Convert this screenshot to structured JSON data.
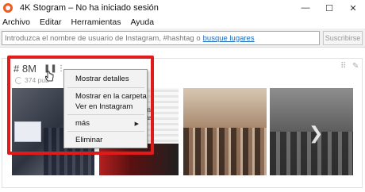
{
  "window": {
    "title": "4K Stogram – No ha iniciado sesión",
    "minimize": "—",
    "maximize": "☐",
    "close": "✕"
  },
  "menubar": {
    "items": [
      "Archivo",
      "Editar",
      "Herramientas",
      "Ayuda"
    ]
  },
  "search": {
    "placeholder": "Introduzca el nombre de usuario de Instagram, #hashtag o",
    "link_text": "busque lugares",
    "subscribe_label": "Suscribirse"
  },
  "card": {
    "hashtag": "# 8M",
    "count_text": "374 pub",
    "thumb2_head": "y",
    "thumb2_sub": "un\nms"
  },
  "context_menu": {
    "items": [
      {
        "label": "Mostrar detalles"
      },
      {
        "label": "Mostrar en la carpeta"
      },
      {
        "label": "Ver en Instagram"
      },
      {
        "label": "más"
      },
      {
        "label": "Eliminar"
      }
    ]
  },
  "colors": {
    "highlight": "#e01b1b",
    "link": "#1a6bc2",
    "app_icon": "#f05a1e"
  }
}
